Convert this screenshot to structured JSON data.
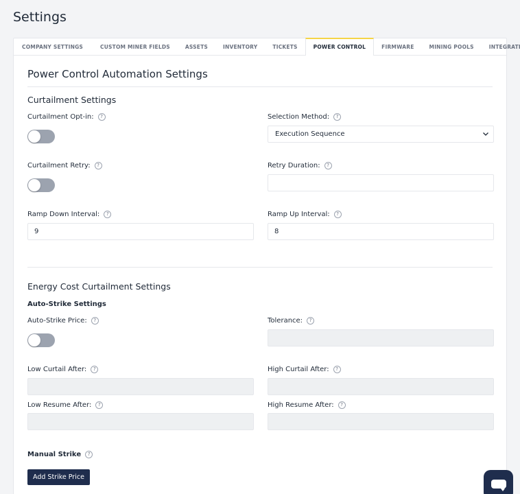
{
  "page": {
    "title": "Settings"
  },
  "tabs": [
    {
      "label": "COMPANY SETTINGS",
      "active": false
    },
    {
      "label": "CUSTOM MINER FIELDS",
      "active": false
    },
    {
      "label": "ASSETS",
      "active": false
    },
    {
      "label": "INVENTORY",
      "active": false
    },
    {
      "label": "TICKETS",
      "active": false
    },
    {
      "label": "POWER CONTROL",
      "active": true
    },
    {
      "label": "FIRMWARE",
      "active": false
    },
    {
      "label": "MINING POOLS",
      "active": false
    },
    {
      "label": "INTEGRATIONS",
      "active": false
    }
  ],
  "main": {
    "heading": "Power Control Automation Settings"
  },
  "curtailment": {
    "heading": "Curtailment Settings",
    "opt_in_label": "Curtailment Opt-in:",
    "opt_in_on": false,
    "selection_method_label": "Selection Method:",
    "selection_method_value": "Execution Sequence",
    "retry_label": "Curtailment Retry:",
    "retry_on": false,
    "retry_duration_label": "Retry Duration:",
    "retry_duration_value": "",
    "ramp_down_label": "Ramp Down Interval:",
    "ramp_down_value": "9",
    "ramp_up_label": "Ramp Up Interval:",
    "ramp_up_value": "8"
  },
  "energy": {
    "heading": "Energy Cost Curtailment Settings",
    "auto_strike_heading": "Auto-Strike Settings",
    "auto_strike_price_label": "Auto-Strike Price:",
    "auto_strike_on": false,
    "tolerance_label": "Tolerance:",
    "low_curtail_label": "Low Curtail After:",
    "high_curtail_label": "High Curtail After:",
    "low_resume_label": "Low Resume After:",
    "high_resume_label": "High Resume After:",
    "manual_strike_heading": "Manual Strike",
    "add_strike_label": "Add Strike Price"
  },
  "help_glyph": "?",
  "colors": {
    "primary": "#1f2d4d",
    "active_tab_accent": "#f5d547",
    "toggle_off": "#9ca3af"
  }
}
